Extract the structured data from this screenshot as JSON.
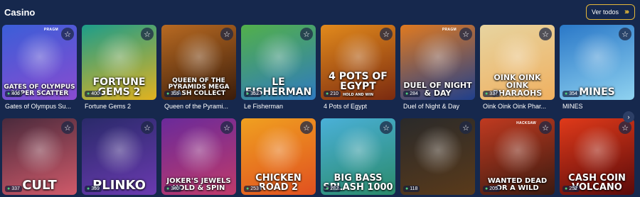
{
  "section": {
    "title": "Casino",
    "view_all_label": "Ver todos"
  },
  "icons": {
    "favorite": "star-icon",
    "players": "user-icon",
    "next": "chevron-right-icon",
    "view_all": "double-chevron-right-icon"
  },
  "row1": [
    {
      "caption": "Gates of Olympus Su...",
      "art_title": "GATES OF OLYMPUS SUPER SCATTER",
      "players": "406",
      "badge": "PRAGM",
      "bg1": "#3b5ed8",
      "bg2": "#8a4bd0"
    },
    {
      "caption": "Fortune Gems 2",
      "art_title": "FORTUNE GEMS 2",
      "players": "400",
      "badge": "",
      "bg1": "#1c9d8a",
      "bg2": "#e2b21f"
    },
    {
      "caption": "Queen of the Pyrami...",
      "art_title": "QUEEN OF THE PYRAMIDS MEGA CASH COLLECT",
      "players": "355",
      "badge": "",
      "bg1": "#b86a22",
      "bg2": "#3a1c0a"
    },
    {
      "caption": "Le Fisherman",
      "art_title": "LE FISHERMAN",
      "players": "352",
      "badge": "",
      "bg1": "#52b04a",
      "bg2": "#2f7ac0"
    },
    {
      "caption": "4 Pots of Egypt",
      "art_title": "4 POTS OF EGYPT",
      "art_subtitle": "HOLD AND WIN",
      "players": "210",
      "badge": "",
      "bg1": "#e28a1c",
      "bg2": "#7a2a10"
    },
    {
      "caption": "Duel of Night & Day",
      "art_title": "DUEL OF NIGHT & DAY",
      "players": "284",
      "badge": "PRAGM",
      "bg1": "#e07a20",
      "bg2": "#1f3f8c"
    },
    {
      "caption": "Oink Oink Oink Phar...",
      "art_title": "OINK OINK OINK PHARAOHS",
      "players": "337",
      "badge": "",
      "bg1": "#e7d4a0",
      "bg2": "#f0b060"
    },
    {
      "caption": "MINES",
      "art_title": "MINES",
      "players": "354",
      "badge": "",
      "bg1": "#2a78c8",
      "bg2": "#8fd2f0"
    }
  ],
  "row2": [
    {
      "art_title": "CULT",
      "players": "337",
      "bg1": "#4a2a3c",
      "bg2": "#d05a6a"
    },
    {
      "art_title": "PLINKO",
      "players": "359",
      "bg1": "#2a2a6a",
      "bg2": "#6a3ab0"
    },
    {
      "art_title": "JOKER'S JEWELS HOLD & SPIN",
      "players": "340",
      "bg1": "#6a2a9a",
      "bg2": "#c03a6a"
    },
    {
      "art_title": "CHICKEN ROAD 2",
      "players": "253",
      "bg1": "#f0a020",
      "bg2": "#e05020"
    },
    {
      "art_title": "BIG BASS SPLASH 1000",
      "players": "282",
      "bg1": "#4ab0d8",
      "bg2": "#2a8a6a"
    },
    {
      "art_title": "",
      "players": "118",
      "bg1": "#2a2a2a",
      "bg2": "#5a3a1a"
    },
    {
      "art_title": "WANTED DEAD OR A WILD",
      "badge": "HACKSAW",
      "players": "205",
      "bg1": "#c03a20",
      "bg2": "#3a1a10"
    },
    {
      "art_title": "CASH COIN VOLCANO",
      "players": "252",
      "bg1": "#e03a1a",
      "bg2": "#5a0a0a"
    }
  ]
}
